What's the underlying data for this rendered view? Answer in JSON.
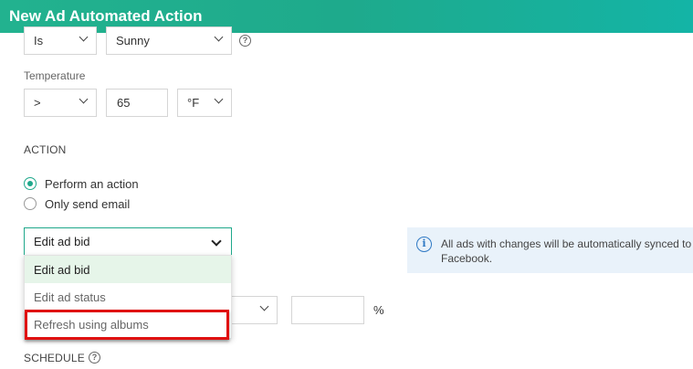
{
  "window": {
    "title": "New Ad Automated Action"
  },
  "condition": {
    "operator_value": "Is",
    "weather_value": "Sunny"
  },
  "temperature": {
    "label": "Temperature",
    "operator_value": ">",
    "value": "65",
    "unit_value": "°F"
  },
  "action": {
    "section_title": "ACTION",
    "radios": [
      {
        "label": "Perform an action",
        "checked": true
      },
      {
        "label": "Only send email",
        "checked": false
      }
    ],
    "dropdown": {
      "selected_value": "Edit ad bid",
      "options": [
        "Edit ad bid",
        "Edit ad status",
        "Refresh using albums"
      ]
    },
    "percent_symbol": "%"
  },
  "info": {
    "line1": "All ads with changes will be automatically synced to",
    "line2": "Facebook."
  },
  "schedule": {
    "section_title": "SCHEDULE"
  },
  "colors": {
    "title_bar": "#1eaa8c",
    "accent": "#1fa88b",
    "highlight": "#e01010",
    "info_bg": "#e9f2fa",
    "info_icon": "#2f79c4"
  },
  "icons": {
    "help": "question-circle-icon",
    "info": "info-circle-icon",
    "chevron": "chevron-down-icon"
  }
}
